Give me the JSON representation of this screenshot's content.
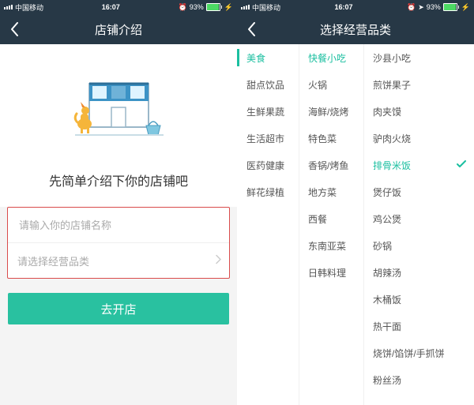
{
  "status": {
    "carrier": "中国移动",
    "time": "16:07",
    "battery": "93%",
    "alarm": "⏰",
    "location": "➤",
    "charge": "⚡"
  },
  "left": {
    "title": "店铺介绍",
    "heading": "先简单介绍下你的店铺吧",
    "name_placeholder": "请输入你的店铺名称",
    "category_placeholder": "请选择经营品类",
    "submit_label": "去开店"
  },
  "right": {
    "title": "选择经营品类",
    "col1": [
      "美食",
      "甜点饮品",
      "生鲜果蔬",
      "生活超市",
      "医药健康",
      "鲜花绿植"
    ],
    "col1_active": 0,
    "col2": [
      "快餐小吃",
      "火锅",
      "海鲜/烧烤",
      "特色菜",
      "香锅/烤鱼",
      "地方菜",
      "西餐",
      "东南亚菜",
      "日韩料理"
    ],
    "col2_active": 0,
    "col3": [
      "沙县小吃",
      "煎饼果子",
      "肉夹馍",
      "驴肉火烧",
      "排骨米饭",
      "煲仔饭",
      "鸡公煲",
      "砂锅",
      "胡辣汤",
      "木桶饭",
      "热干面",
      "烧饼/馅饼/手抓饼",
      "粉丝汤"
    ],
    "col3_active": 4
  }
}
